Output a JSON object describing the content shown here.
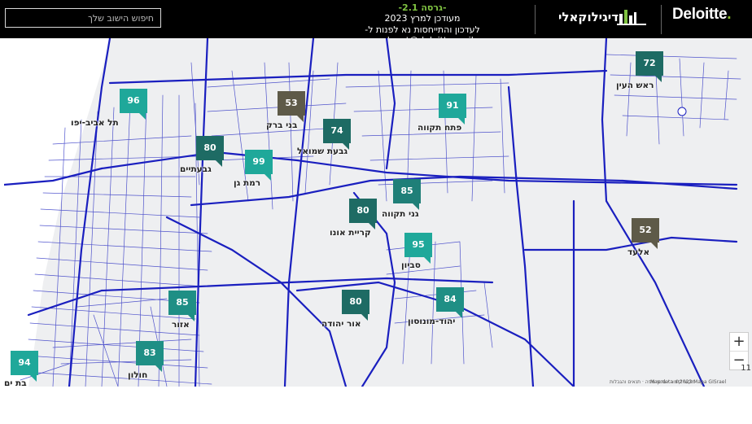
{
  "header": {
    "search_placeholder": "חיפוש הישוב שלך",
    "version": "-גרסה 2.1-",
    "updated": "מעודכן למרץ 2023",
    "contact": "לעדכון והתייחסות נא לפנות ל- nzalayet@deloitte.co.il",
    "digital_brand": "דיגילוקאלי",
    "deloitte_brand": "Deloitte",
    "deloitte_dot": "."
  },
  "map": {
    "markers": [
      {
        "value": "96",
        "color": "#1fa89a"
      },
      {
        "value": "53",
        "color": "#5e5a48"
      },
      {
        "value": "91",
        "color": "#1fa89a"
      },
      {
        "value": "72",
        "color": "#1e6b64"
      },
      {
        "value": "74",
        "color": "#1e6b64"
      },
      {
        "value": "80",
        "color": "#1e6b64"
      },
      {
        "value": "99",
        "color": "#1fa89a"
      },
      {
        "value": "85",
        "color": "#1f7f78"
      },
      {
        "value": "80",
        "color": "#1e6b64"
      },
      {
        "value": "95",
        "color": "#1fa89a"
      },
      {
        "value": "52",
        "color": "#5e5a48"
      },
      {
        "value": "85",
        "color": "#1f8f85"
      },
      {
        "value": "80",
        "color": "#1e6b64"
      },
      {
        "value": "84",
        "color": "#1f8f85"
      },
      {
        "value": "83",
        "color": "#1f8f85"
      },
      {
        "value": "94",
        "color": "#1fa89a"
      }
    ],
    "cities": [
      "תל אביב-יפו",
      "בני ברק",
      "פתח תקווה",
      "ראש העין",
      "גבעת שמואל",
      "גבעתיים",
      "רמת גן",
      "קריית אונו",
      "גני תקווה",
      "סביון",
      "אלעד",
      "אור יהודה",
      "יהוד-מונוסון",
      "אזור",
      "חולון",
      "בת ים"
    ],
    "road_color": "#1a1fbf",
    "zoom_in": "+",
    "zoom_out": "−",
    "attribution_right": "Map data ©2023 Mapa GISrael",
    "attribution_left": "מקשי קיצור · נתוני מפה ·  תנאים והגבלות",
    "page_indicator": "11"
  }
}
